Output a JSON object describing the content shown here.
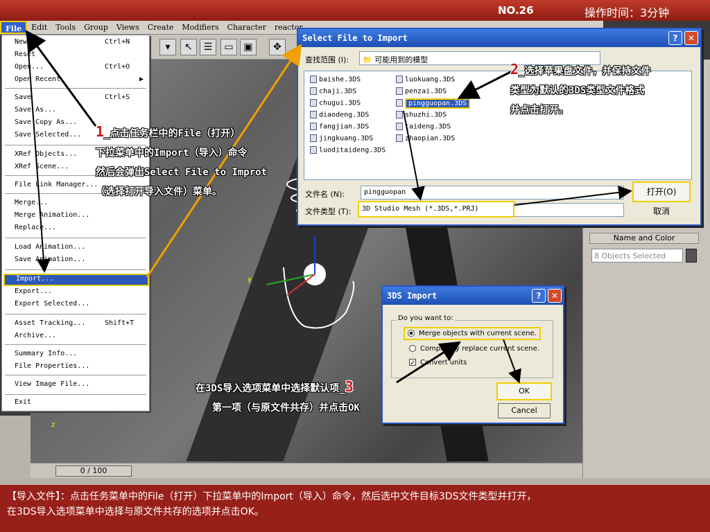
{
  "top": {
    "number": "NO.26",
    "time": "操作时间：3分钟"
  },
  "menubar": [
    "File",
    "Edit",
    "Tools",
    "Group",
    "Views",
    "Create",
    "Modifiers",
    "Character",
    "reactor"
  ],
  "filemenu": {
    "items": [
      {
        "label": "New...",
        "shortcut": "Ctrl+N"
      },
      {
        "label": "Reset",
        "shortcut": ""
      },
      {
        "label": "Open...",
        "shortcut": "Ctrl+O"
      },
      {
        "label": "Open Recent",
        "shortcut": "▶"
      },
      {
        "label": "Save",
        "shortcut": "Ctrl+S"
      },
      {
        "label": "Save As...",
        "shortcut": ""
      },
      {
        "label": "Save Copy As...",
        "shortcut": ""
      },
      {
        "label": "Save Selected...",
        "shortcut": ""
      },
      {
        "label": "XRef Objects...",
        "shortcut": ""
      },
      {
        "label": "XRef Scene...",
        "shortcut": ""
      },
      {
        "label": "File Link Manager...",
        "shortcut": ""
      },
      {
        "label": "Merge...",
        "shortcut": ""
      },
      {
        "label": "Merge Animation...",
        "shortcut": ""
      },
      {
        "label": "Replace...",
        "shortcut": ""
      },
      {
        "label": "Load Animation...",
        "shortcut": ""
      },
      {
        "label": "Save Animation...",
        "shortcut": ""
      },
      {
        "label": "Import...",
        "shortcut": ""
      },
      {
        "label": "Export...",
        "shortcut": ""
      },
      {
        "label": "Export Selected...",
        "shortcut": ""
      },
      {
        "label": "Asset Tracking...",
        "shortcut": "Shift+T"
      },
      {
        "label": "Archive...",
        "shortcut": ""
      },
      {
        "label": "Summary Info...",
        "shortcut": ""
      },
      {
        "label": "File Properties...",
        "shortcut": ""
      },
      {
        "label": "View Image File...",
        "shortcut": ""
      },
      {
        "label": "Exit",
        "shortcut": ""
      }
    ]
  },
  "select_file": {
    "title": "Select File to Import",
    "lookin_label": "查找范围 (I):",
    "lookin_value": "可能用到的模型",
    "files_col1": [
      "baishe.3DS",
      "chaji.3DS",
      "chugui.3DS",
      "diaodeng.3DS",
      "fangjian.3DS",
      "jingkuang.3DS",
      "luoditaideng.3DS"
    ],
    "files_col2": [
      "luokuang.3DS",
      "penzai.3DS",
      "pingguopan.3DS",
      "shuzhi.3DS",
      "taideng.3DS",
      "zhaopian.3DS"
    ],
    "filename_label": "文件名 (N):",
    "filename_value": "pingguopan",
    "filetype_label": "文件类型 (T):",
    "filetype_value": "3D Studio Mesh (*.3DS,*.PRJ)",
    "open_label": "打开(O)",
    "cancel_label": "取消"
  },
  "import_dialog": {
    "title": "3DS Import",
    "legend": "Do you want to:",
    "opt_merge": "Merge objects with current scene.",
    "opt_replace": "Completely replace current scene.",
    "opt_units": "Convert units",
    "ok_label": "OK",
    "cancel_label": "Cancel"
  },
  "command_panel": {
    "name_color": "Name and Color",
    "selected": "8 Objects Selected"
  },
  "timeline": {
    "frame": "0 / 100"
  },
  "annotations": {
    "step1_num": "1",
    "step1_lines": [
      "_点击任务栏中的File（打开）",
      "下拉菜单中的Import（导入）命令",
      "然后会弹出Select File to Improt",
      "（选择打开导入文件）菜单。"
    ],
    "step2_num": "2",
    "step2_lines": [
      "_选择苹果盘文件，并保持文件",
      "类型为默认的3DS类型文件格式",
      "并点击打开。"
    ],
    "step3_num": "3",
    "step3_lines": [
      "在3DS导入选项菜单中选择默认项_",
      "第一项（与原文件共存）并点击OK"
    ]
  },
  "caption": {
    "line1": "【导入文件】：点击任务菜单中的File（打开）下拉菜单中的Import（导入）命令，然后选中文件目标3DS文件类型并打开，",
    "line2": "在3DS导入选项菜单中选择与原文件共存的选项并点击OK。"
  }
}
